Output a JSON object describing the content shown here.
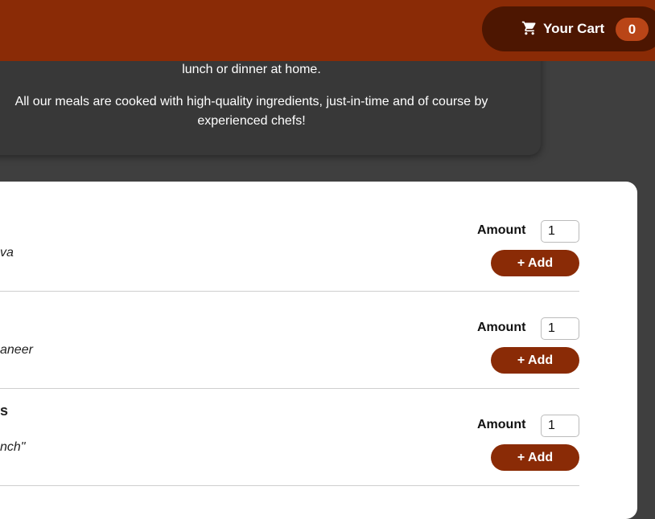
{
  "header": {
    "cart": {
      "label": "Your Cart",
      "count": "0",
      "icon": "cart-icon"
    }
  },
  "summary": {
    "line1": "lunch or dinner at home.",
    "line2": "All our meals are cooked with high-quality ingredients, just-in-time and of course by experienced chefs!"
  },
  "meals": [
    {
      "name": "",
      "description": "va",
      "amount_label": "Amount",
      "amount": "1",
      "add_label": "+ Add"
    },
    {
      "name": "",
      "description": "aneer",
      "amount_label": "Amount",
      "amount": "1",
      "add_label": "+ Add"
    },
    {
      "name": "s",
      "description": "nch\"",
      "amount_label": "Amount",
      "amount": "1",
      "add_label": "+ Add"
    }
  ],
  "colors": {
    "brand": "#8a2b06",
    "cart_bg": "#4d1601",
    "badge": "#b94517",
    "page_bg": "#3f3f3f"
  }
}
